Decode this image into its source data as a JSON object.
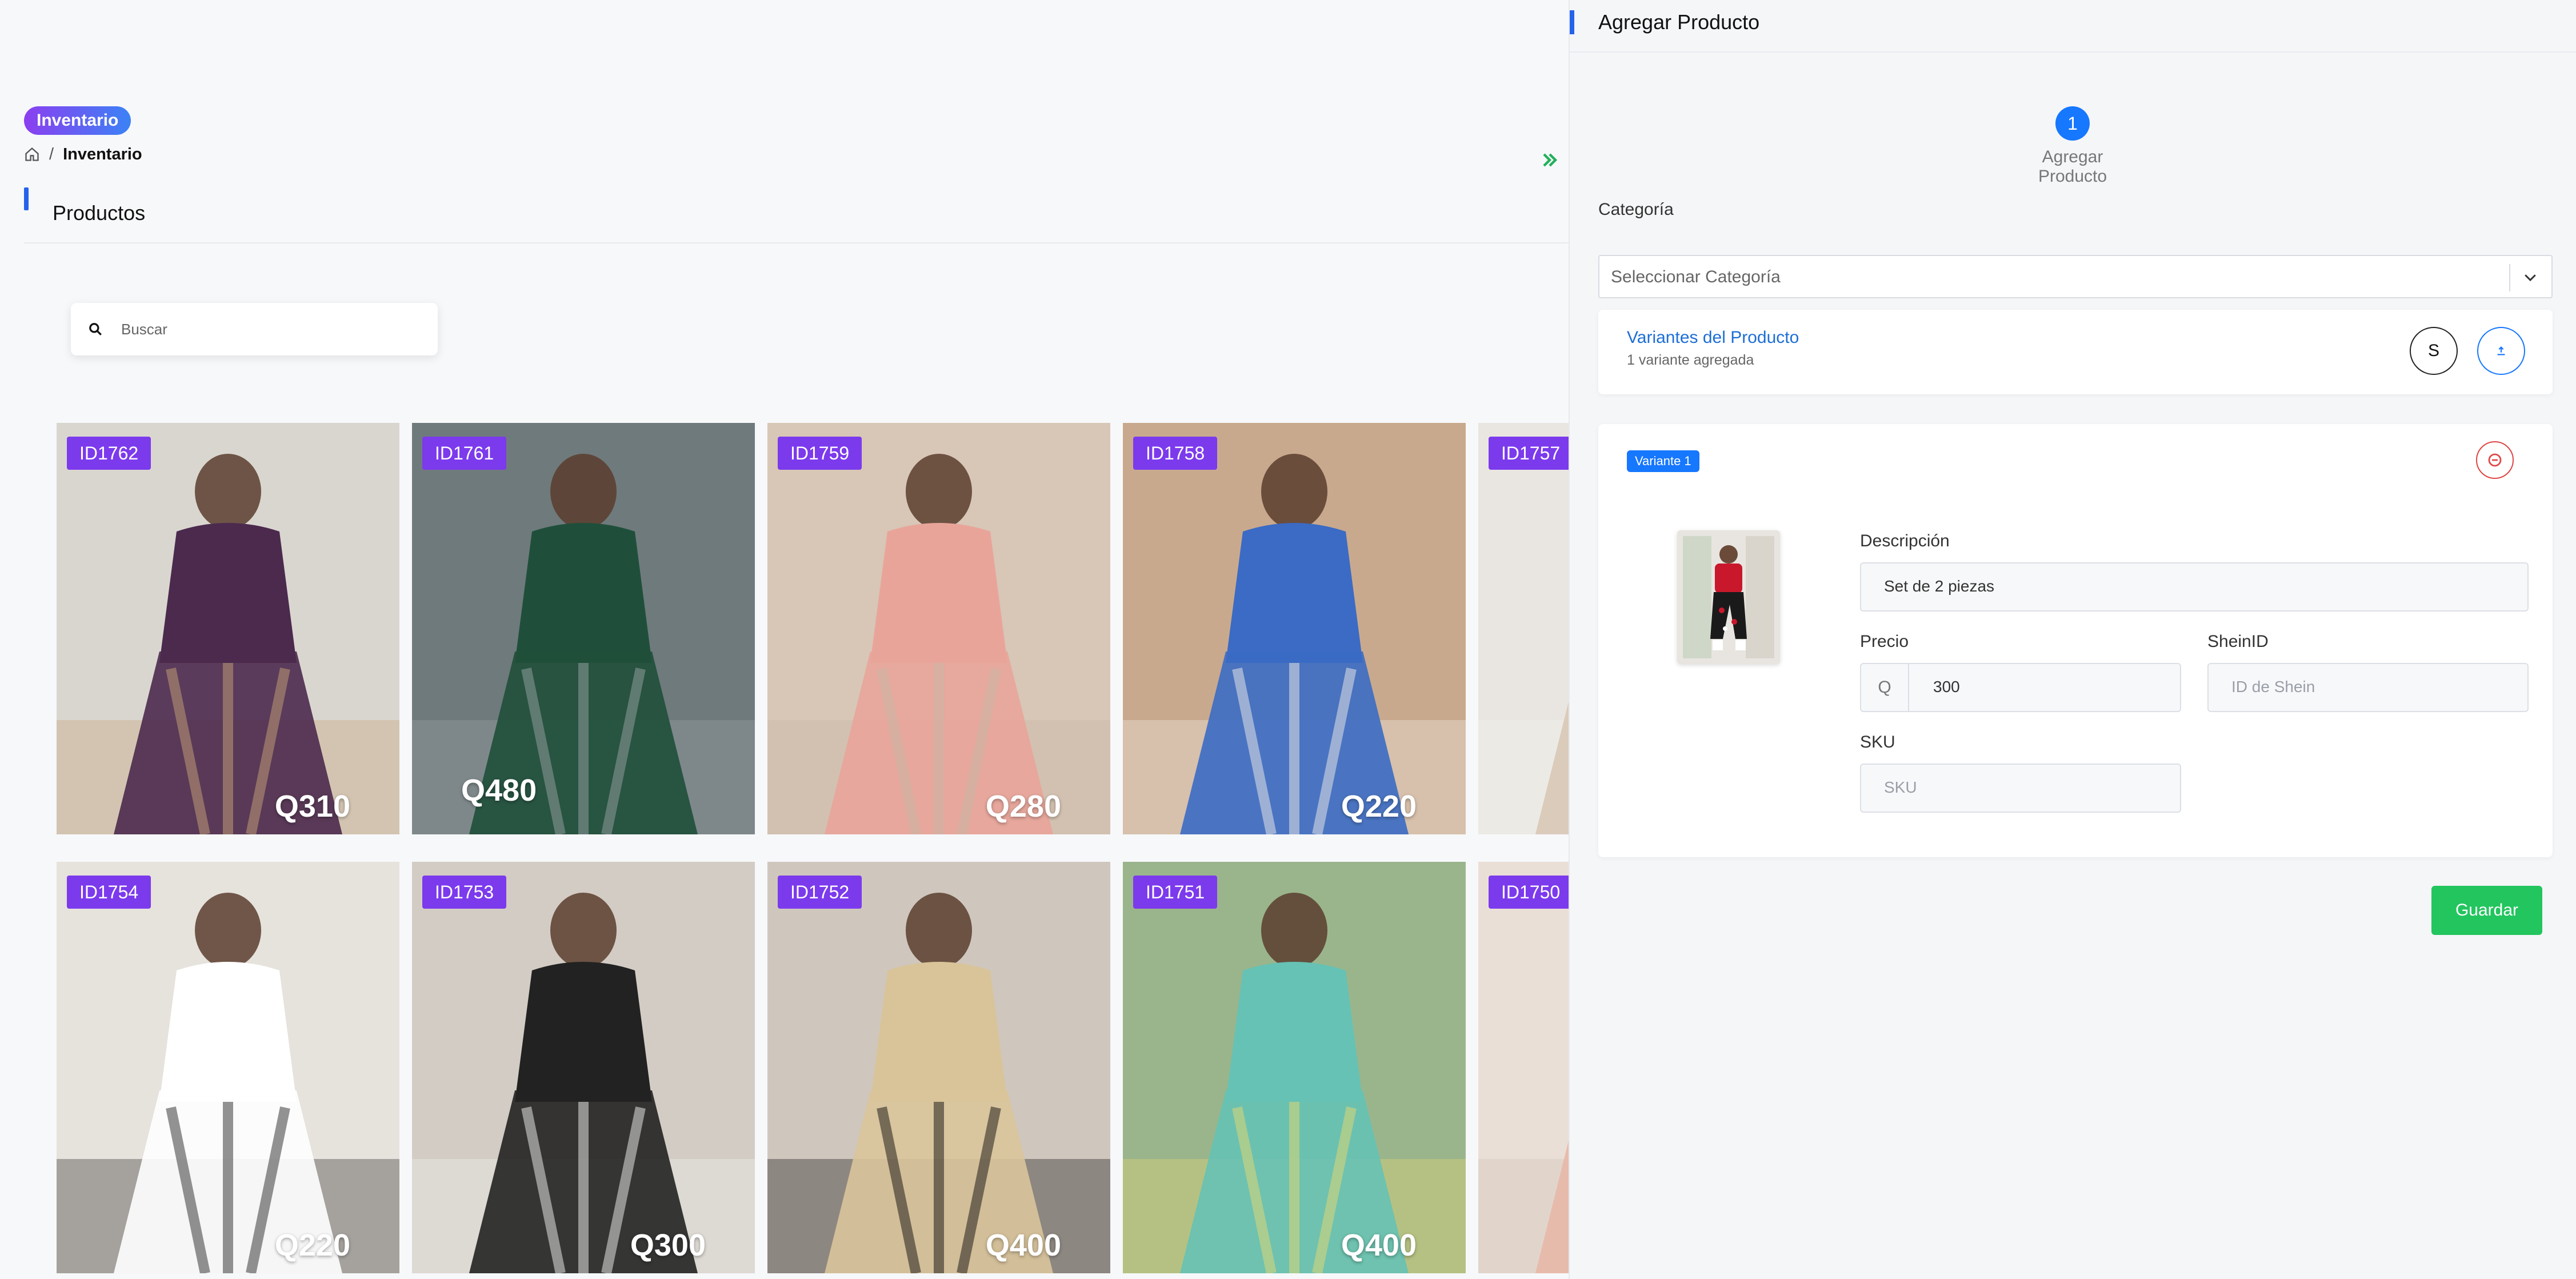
{
  "section_badge": "Inventario",
  "breadcrumb": {
    "current": "Inventario",
    "separator": "/"
  },
  "products": {
    "title": "Productos"
  },
  "search": {
    "placeholder": "Buscar"
  },
  "cards": [
    {
      "id": "ID1762",
      "price": "Q310",
      "colors": [
        "#d9d6cf",
        "#4b2a4e",
        "#c9a377"
      ]
    },
    {
      "id": "ID1761",
      "price": "Q480",
      "colors": [
        "#6f7a7c",
        "#1f4f3a",
        "#9aa3a5"
      ]
    },
    {
      "id": "ID1759",
      "price": "Q280",
      "colors": [
        "#d8c6b6",
        "#e9a49a",
        "#c8b8a6"
      ]
    },
    {
      "id": "ID1758",
      "price": "Q220",
      "colors": [
        "#c9a98d",
        "#3b6bc4",
        "#f1efe9"
      ]
    },
    {
      "id": "ID1757",
      "price": "",
      "colors": [
        "#e9e6e1",
        "#d9c8b6",
        "#f4f2ee"
      ]
    },
    {
      "id": "ID1754",
      "price": "Q220",
      "colors": [
        "#e6e2dc",
        "#ffffff",
        "#2b2b2b"
      ]
    },
    {
      "id": "ID1753",
      "price": "Q300",
      "colors": [
        "#d3ccc4",
        "#222222",
        "#f2f2f2"
      ]
    },
    {
      "id": "ID1752",
      "price": "Q400",
      "colors": [
        "#cfc7bd",
        "#d9c49a",
        "#111111"
      ]
    },
    {
      "id": "ID1751",
      "price": "Q400",
      "colors": [
        "#9ab58c",
        "#66c2b4",
        "#e8d870"
      ]
    },
    {
      "id": "ID1750",
      "price": "",
      "colors": [
        "#eadfd6",
        "#e8b8a8",
        "#d1c2b8"
      ]
    }
  ],
  "panel": {
    "title": "Agregar Producto",
    "step": {
      "number": "1",
      "label": "Agregar Producto"
    },
    "category": {
      "label": "Categoría",
      "placeholder": "Seleccionar Categoría"
    },
    "variants": {
      "title": "Variantes del Producto",
      "subtitle": "1 variante agregada",
      "size_chip": "S"
    },
    "variant": {
      "tag": "Variante 1",
      "description_label": "Descripción",
      "description_value": "Set de 2 piezas",
      "price_label": "Precio",
      "price_prefix": "Q",
      "price_value": "300",
      "sheinid_label": "SheinID",
      "sheinid_placeholder": "ID de Shein",
      "sku_label": "SKU",
      "sku_placeholder": "SKU"
    },
    "save_label": "Guardar"
  },
  "colors": {
    "accent": "#2563eb",
    "primary": "#1677ff",
    "badge_purple": "#7c3aed",
    "save_green": "#22c55e",
    "danger": "#e04545"
  },
  "icons": [
    "home-icon",
    "search-icon",
    "double-chevron-right-icon",
    "chevron-down-icon",
    "upload-icon",
    "minus-circle-icon"
  ]
}
